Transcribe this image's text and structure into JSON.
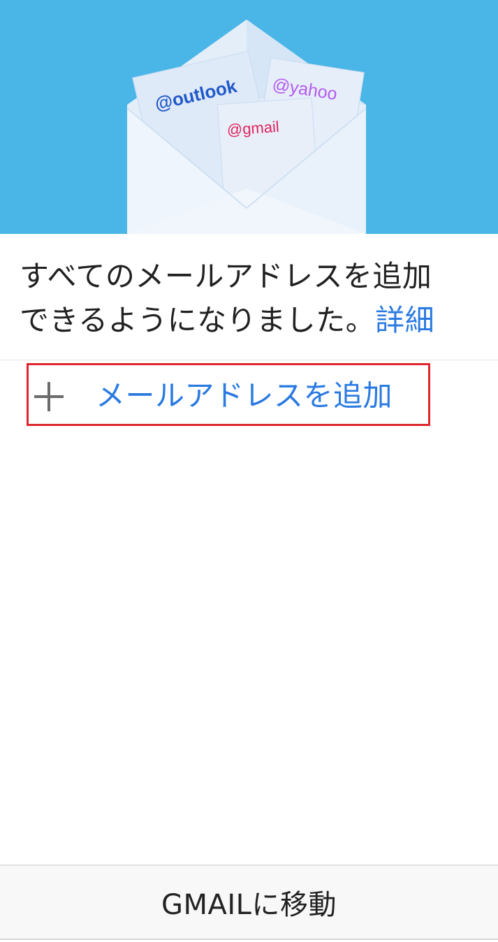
{
  "hero": {
    "envelope_icon": "envelope-with-cards-illustration",
    "cards": [
      {
        "label": "@outlook",
        "color": "#2259c9"
      },
      {
        "label": "@yahoo",
        "color": "#b45bf0"
      },
      {
        "label": "@gmail",
        "color": "#e0245e"
      }
    ],
    "background_color": "#49b5e6"
  },
  "info": {
    "line1": "すべてのメールアドレスを追加",
    "line2": "できるようになりました。",
    "details_link": "詳細"
  },
  "add_address": {
    "icon": "plus-icon",
    "label": "メールアドレスを追加"
  },
  "footer": {
    "go_to_gmail_label": "GMAILに移動"
  },
  "colors": {
    "accent": "#2a7ae2",
    "highlight_border": "#e0252e"
  }
}
